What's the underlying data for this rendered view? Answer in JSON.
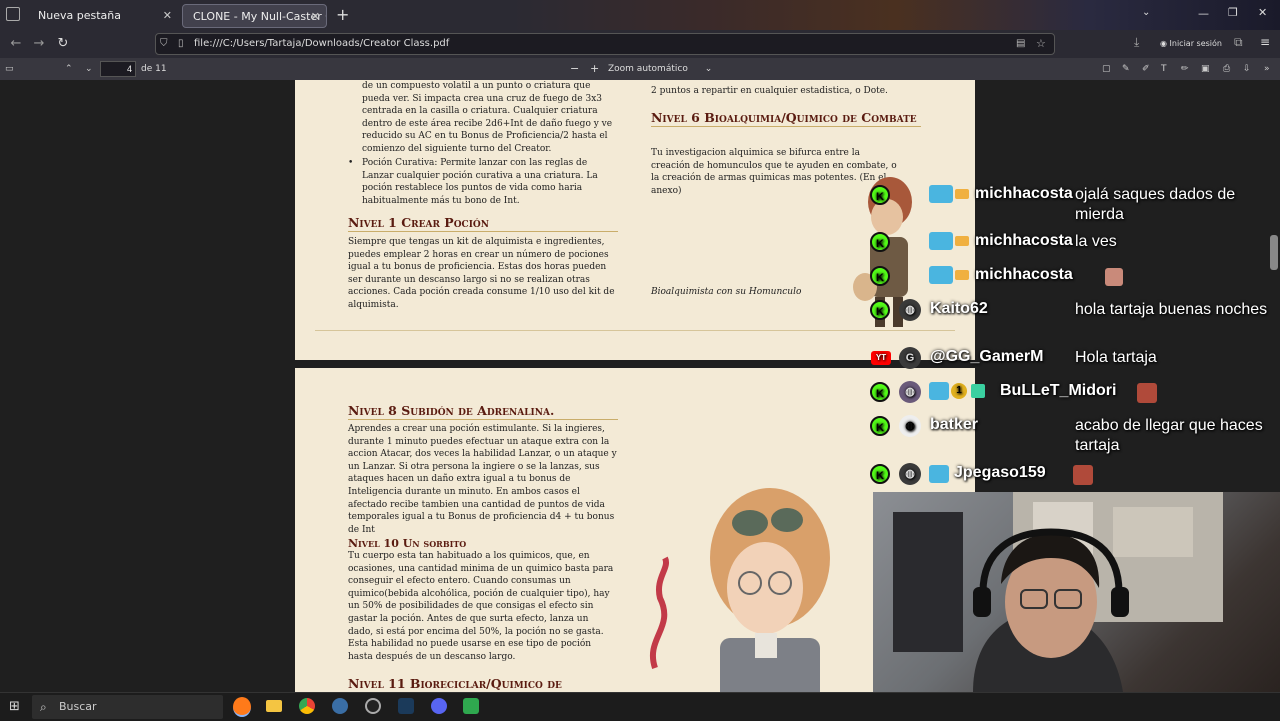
{
  "browser": {
    "tabs": [
      {
        "label": "Nueva pestaña"
      },
      {
        "label": "CLONE - My Null-Caster Class - The"
      }
    ],
    "url": "file:///C:/Users/Tartaja/Downloads/Creator Class.pdf",
    "signin_label": "Iniciar sesión"
  },
  "pdf_toolbar": {
    "current_page": "4",
    "page_total": "de 11",
    "zoom": "Zoom automático",
    "minus": "−",
    "plus": "+"
  },
  "page1": {
    "left_top_text": "de un compuesto volatil a un punto o criatura que pueda ver. Si impacta crea una cruz de fuego de 3x3 centrada en la casilla o criatura. Cualquier criatura dentro de este área recibe 2d6+Int de daño fuego y ve reducido su AC en tu Bonus de Proficiencia/2 hasta el comienzo del siguiente turno del Creator.",
    "bullet_text": "Poción Curativa: Permite lanzar con las reglas de Lanzar cualquier poción curativa a una criatura. La poción restablece los puntos de vida como haria habitualmente más tu bono de Int.",
    "heading1": "Nivel 1 Crear Poción",
    "body1": "Siempre que tengas un kit de alquimista e ingredientes, puedes emplear 2 horas en crear un número de pociones igual a tu bonus de proficiencia. Estas dos horas pueden ser durante un descanso largo si no se realizan otras acciones. Cada poción creada consume 1/10 uso del kit de alquimista.",
    "right_top": "2 puntos a repartir en cualquier estadistica, o Dote.",
    "heading6": "Nivel 6 Bioalquimia/Quimico de Combate",
    "body6": "Tu investigacion alquimica se bifurca entre la creación de homunculos que te ayuden en combate, o la creación de armas quimicas mas potentes. (En el anexo)",
    "caption": "Bioalquimista con su Homunculo"
  },
  "page2": {
    "heading8": "Nivel 8 Subidón de Adrenalina.",
    "body8": "Aprendes a crear una poción estimulante. Si la ingieres, durante 1 minuto puedes efectuar un ataque extra con la accion Atacar, dos veces la habilidad Lanzar, o un ataque y un Lanzar. Si otra persona la ingiere o se la lanzas, sus ataques hacen un daño extra igual a tu bonus de Inteligencia durante un minuto. En ambos casos el afectado recibe tambien una cantidad de puntos de vida temporales igual a tu Bonus de proficiencia d4 + tu bonus de Int",
    "heading10": "Nivel 10 Un sorbito",
    "body10": "Tu cuerpo esta tan habituado a los quimicos, que, en ocasiones, una cantidad minima de un quimico basta para conseguir el efecto entero. Cuando consumas un quimico(bebida alcohólica, poción de cualquier tipo), hay un 50% de posibilidades de que consigas el efecto sin gastar la poción. Antes de que surta efecto, lanza un dado, si está por encima del 50%, la poción no se gasta. Esta habilidad no puede usarse en ese tipo de poción hasta después de un descanso largo.",
    "heading11": "Nivel 11 Bioreciclar/Quimico de"
  },
  "chat": [
    {
      "badge": "K",
      "user": "michhacosta",
      "message": "ojalá saques dados de mierda"
    },
    {
      "badge": "K",
      "user": "michhacosta",
      "message": "la ves"
    },
    {
      "badge": "K",
      "user": "michhacosta",
      "message": ""
    },
    {
      "badge": "K",
      "user": "Kaito62",
      "message": "hola tartaja buenas noches"
    },
    {
      "badge": "YT",
      "avatar": "G",
      "user": "@GG_GamerM",
      "message": "Hola tartaja"
    },
    {
      "badge": "K",
      "user": "BuLLeT_Midori",
      "message": ""
    },
    {
      "badge": "K",
      "user": "batker",
      "message": "acabo de llegar que haces tartaja"
    },
    {
      "badge": "K",
      "user": "Jpegaso159",
      "message": ""
    }
  ],
  "taskbar": {
    "search_placeholder": "Buscar"
  }
}
